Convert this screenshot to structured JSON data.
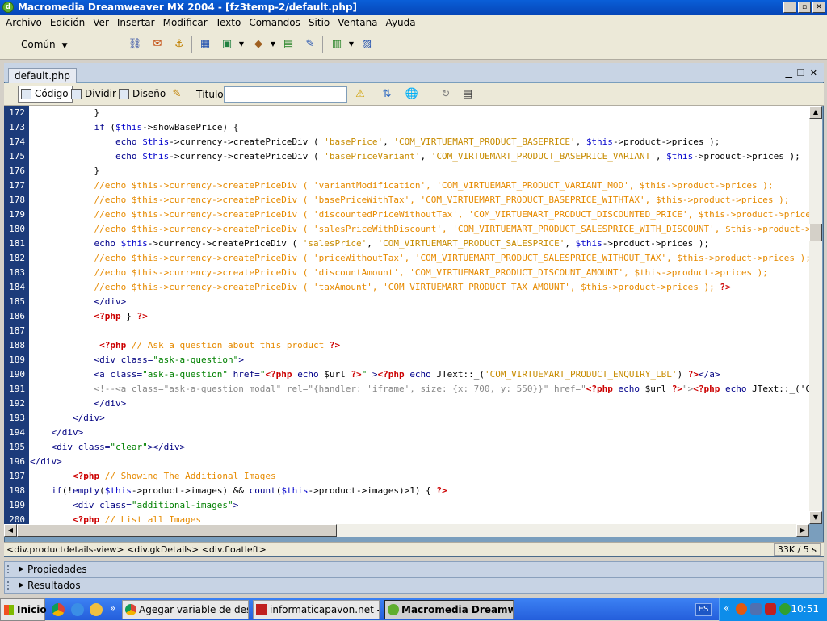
{
  "window": {
    "title": "Macromedia Dreamweaver MX 2004 - [fz3temp-2/default.php]",
    "controls": [
      "_",
      "▫",
      "✕"
    ]
  },
  "menu": [
    "Archivo",
    "Edición",
    "Ver",
    "Insertar",
    "Modificar",
    "Texto",
    "Comandos",
    "Sitio",
    "Ventana",
    "Ayuda"
  ],
  "insertbar": {
    "category": "Común"
  },
  "document": {
    "tab": "default.php",
    "view_buttons": {
      "code": "Código",
      "split": "Dividir",
      "design": "Diseño"
    },
    "title_label": "Título:",
    "title_value": ""
  },
  "code_lines": [
    {
      "n": "172",
      "html": "            }"
    },
    {
      "n": "173",
      "html": "            <span class=\"kw\">if</span> (<span class=\"var\">$this</span>->showBasePrice) {"
    },
    {
      "n": "174",
      "html": "                <span class=\"kw\">echo</span> <span class=\"var\">$this</span>->currency->createPriceDiv ( <span class=\"str\">'basePrice'</span>, <span class=\"str\">'COM_VIRTUEMART_PRODUCT_BASEPRICE'</span>, <span class=\"var\">$this</span>->product->prices );"
    },
    {
      "n": "175",
      "html": "                <span class=\"kw\">echo</span> <span class=\"var\">$this</span>->currency->createPriceDiv ( <span class=\"str\">'basePriceVariant'</span>, <span class=\"str\">'COM_VIRTUEMART_PRODUCT_BASEPRICE_VARIANT'</span>, <span class=\"var\">$this</span>->product->prices );"
    },
    {
      "n": "176",
      "html": "            }"
    },
    {
      "n": "177",
      "html": "            <span class=\"cm\">//echo $this->currency->createPriceDiv ( 'variantModification', 'COM_VIRTUEMART_PRODUCT_VARIANT_MOD', $this->product->prices );</span>"
    },
    {
      "n": "178",
      "html": "            <span class=\"cm\">//echo $this->currency->createPriceDiv ( 'basePriceWithTax', 'COM_VIRTUEMART_PRODUCT_BASEPRICE_WITHTAX', $this->product->prices );</span>"
    },
    {
      "n": "179",
      "html": "            <span class=\"cm\">//echo $this->currency->createPriceDiv ( 'discountedPriceWithoutTax', 'COM_VIRTUEMART_PRODUCT_DISCOUNTED_PRICE', $this->product->prices );</span>"
    },
    {
      "n": "180",
      "html": "            <span class=\"cm\">//echo $this->currency->createPriceDiv ( 'salesPriceWithDiscount', 'COM_VIRTUEMART_PRODUCT_SALESPRICE_WITH_DISCOUNT', $this->product->prices );</span>"
    },
    {
      "n": "181",
      "html": "            <span class=\"kw\">echo</span> <span class=\"var\">$this</span>->currency->createPriceDiv ( <span class=\"str\">'salesPrice'</span>, <span class=\"str\">'COM_VIRTUEMART_PRODUCT_SALESPRICE'</span>, <span class=\"var\">$this</span>->product->prices );"
    },
    {
      "n": "182",
      "html": "            <span class=\"cm\">//echo $this->currency->createPriceDiv ( 'priceWithoutTax', 'COM_VIRTUEMART_PRODUCT_SALESPRICE_WITHOUT_TAX', $this->product->prices );</span>"
    },
    {
      "n": "183",
      "html": "            <span class=\"cm\">//echo $this->currency->createPriceDiv ( 'discountAmount', 'COM_VIRTUEMART_PRODUCT_DISCOUNT_AMOUNT', $this->product->prices );</span>"
    },
    {
      "n": "184",
      "html": "            <span class=\"cm\">//echo $this->currency->createPriceDiv ( 'taxAmount', 'COM_VIRTUEMART_PRODUCT_TAX_AMOUNT', $this->product->prices ); </span><span class=\"php\">?></span>"
    },
    {
      "n": "185",
      "html": "            <span class=\"tag\">&lt;/div&gt;</span>"
    },
    {
      "n": "186",
      "html": "            <span class=\"php\">&lt;?php</span> } <span class=\"php\">?></span>"
    },
    {
      "n": "187",
      "html": ""
    },
    {
      "n": "188",
      "html": "             <span class=\"php\">&lt;?php</span> <span class=\"cm\">// Ask a question about this product </span><span class=\"php\">?></span>"
    },
    {
      "n": "189",
      "html": "            <span class=\"tag\">&lt;div class=<span class=\"tstr\">\"ask-a-question\"</span>&gt;</span>"
    },
    {
      "n": "190",
      "html": "            <span class=\"tag\">&lt;a class=<span class=\"tstr\">\"ask-a-question\"</span> href=<span class=\"tstr\">\"</span></span><span class=\"php\">&lt;?php</span> <span class=\"kw\">echo</span> $url <span class=\"php\">?></span><span class=\"tag\"><span class=\"tstr\">\"</span> &gt;</span><span class=\"php\">&lt;?php</span> <span class=\"kw\">echo</span> JText::_(<span class=\"str\">'COM_VIRTUEMART_PRODUCT_ENQUIRY_LBL'</span>) <span class=\"php\">?></span><span class=\"tag\">&lt;/a&gt;</span>"
    },
    {
      "n": "191",
      "html": "            <span style=\"color:#888\">&lt;!--&lt;a class=\"ask-a-question modal\" rel=\"{handler: 'iframe', size: {x: 700, y: 550}}\" href=\"</span><span class=\"php\">&lt;?php</span> <span class=\"kw\">echo</span> $url <span class=\"php\">?></span><span style=\"color:#888\">\"&gt;</span><span class=\"php\">&lt;?php</span> <span class=\"kw\">echo</span> JText::_('COM_VIRTUEMART_PRODUCT_ENQUIRY_LBL') ?&gt;&lt;/a&gt;--&gt;"
    },
    {
      "n": "192",
      "html": "            <span class=\"tag\">&lt;/div&gt;</span>"
    },
    {
      "n": "193",
      "html": "        <span class=\"tag\">&lt;/div&gt;</span>"
    },
    {
      "n": "194",
      "html": "    <span class=\"tag\">&lt;/div&gt;</span>"
    },
    {
      "n": "195",
      "html": "    <span class=\"tag\">&lt;div class=<span class=\"tstr\">\"clear\"</span>&gt;&lt;/div&gt;</span>"
    },
    {
      "n": "196",
      "html": "<span class=\"tag\">&lt;/div&gt;</span>"
    },
    {
      "n": "197",
      "html": "        <span class=\"php\">&lt;?php</span> <span class=\"cm\">// Showing The Additional Images</span>"
    },
    {
      "n": "198",
      "html": "    <span class=\"kw\">if</span>(!<span class=\"kw\">empty</span>(<span class=\"var\">$this</span>->product->images) && <span class=\"kw\">count</span>(<span class=\"var\">$this</span>->product->images)>1) { <span class=\"php\">?></span>"
    },
    {
      "n": "199",
      "html": "        <span class=\"tag\">&lt;div class=<span class=\"tstr\">\"additional-images\"</span>&gt;</span>"
    },
    {
      "n": "200",
      "html": "        <span class=\"php\">&lt;?php</span> <span class=\"cm\">// List all Images</span>"
    }
  ],
  "statusbar": {
    "breadcrumb": "<div.productdetails-view> <div.gkDetails> <div.floatleft>",
    "info": "33K / 5 s"
  },
  "panels": {
    "properties": "Propiedades",
    "results": "Resultados"
  },
  "taskbar": {
    "start": "Inicio",
    "tasks": [
      "Agegar variable de descr...",
      "informaticapavon.net - i...",
      "Macromedia Dreamw..."
    ],
    "language": "ES",
    "clock": "10:51"
  }
}
